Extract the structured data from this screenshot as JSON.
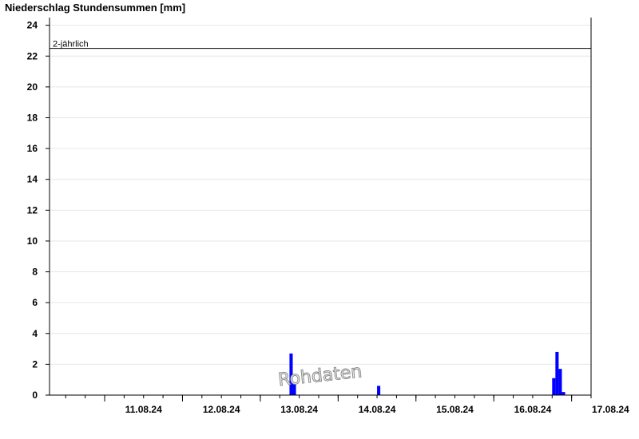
{
  "chart_data": {
    "type": "bar",
    "title": "Niederschlag Stundensummen [mm]",
    "xlabel": "",
    "ylabel": "",
    "ylim": [
      0,
      24.5
    ],
    "y_ticks": [
      0,
      2,
      4,
      6,
      8,
      10,
      12,
      14,
      16,
      18,
      20,
      22,
      24
    ],
    "x_range": [
      "10.08.24 07:00",
      "17.08.24 06:00"
    ],
    "x_ticks": [
      "11.08.24",
      "12.08.24",
      "13.08.24",
      "14.08.24",
      "15.08.24",
      "16.08.24",
      "17.08.24"
    ],
    "grid": true,
    "bar_color": "#0000ff",
    "series": [
      {
        "values": [
          {
            "time": "13.08.24 09:00",
            "value": 2.7
          },
          {
            "time": "13.08.24 10:00",
            "value": 0.8
          },
          {
            "time": "14.08.24 12:00",
            "value": 0.6
          },
          {
            "time": "16.08.24 18:00",
            "value": 1.1
          },
          {
            "time": "16.08.24 19:00",
            "value": 2.8
          },
          {
            "time": "16.08.24 20:00",
            "value": 1.7
          },
          {
            "time": "16.08.24 21:00",
            "value": 0.2
          }
        ]
      }
    ],
    "threshold": {
      "label": "2-jährlich",
      "value": 22.5
    },
    "watermark": "Rohdaten"
  }
}
